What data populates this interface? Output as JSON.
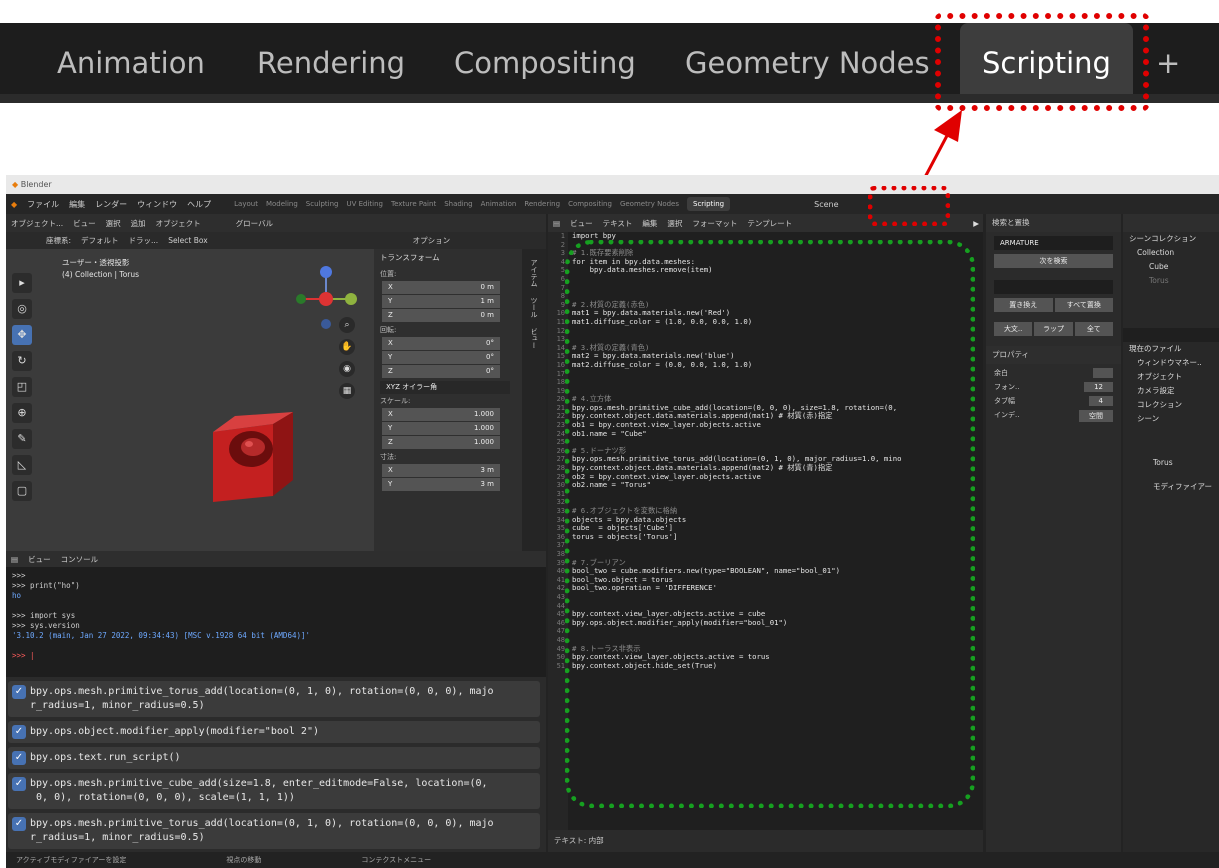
{
  "zoom_tabs": {
    "items": [
      "Animation",
      "Rendering",
      "Compositing",
      "Geometry Nodes"
    ],
    "active": "Scripting",
    "add": "+"
  },
  "window": {
    "title": "Blender"
  },
  "menu": {
    "items": [
      "ファイル",
      "編集",
      "レンダー",
      "ウィンドウ",
      "ヘルプ"
    ],
    "workspaces": [
      "Layout",
      "Modeling",
      "Sculpting",
      "UV Editing",
      "Texture Paint",
      "Shading",
      "Animation",
      "Rendering",
      "Compositing",
      "Geometry Nodes"
    ],
    "active_workspace": "Scripting",
    "scene": "Scene"
  },
  "viewport": {
    "header": [
      "オブジェクト...",
      "ビュー",
      "選択",
      "追加",
      "オブジェクト",
      "グローバル"
    ],
    "sub": [
      "座標系:",
      "デフォルト",
      "ドラッ...",
      "Select Box"
    ],
    "options": "オプション",
    "info_line1": "ユーザー・透視投影",
    "info_line2": "(4) Collection | Torus",
    "npanel": {
      "transform": "トランスフォーム",
      "location": "位置:",
      "loc": [
        [
          "X",
          "0 m"
        ],
        [
          "Y",
          "1 m"
        ],
        [
          "Z",
          "0 m"
        ]
      ],
      "rotation": "回転:",
      "rot": [
        [
          "X",
          "0°"
        ],
        [
          "Y",
          "0°"
        ],
        [
          "Z",
          "0°"
        ]
      ],
      "mode": "XYZ オイラー角",
      "scale": "スケール:",
      "scl": [
        [
          "X",
          "1.000"
        ],
        [
          "Y",
          "1.000"
        ],
        [
          "Z",
          "1.000"
        ]
      ],
      "dims": "寸法:",
      "dim": [
        [
          "X",
          "3 m"
        ],
        [
          "Y",
          "3 m"
        ]
      ]
    },
    "tabs": [
      "アイテム",
      "ツール",
      "ビュー"
    ]
  },
  "console": {
    "header": [
      "ビュー",
      "コンソール"
    ],
    "lines": [
      {
        "cls": "in",
        "t": ">>>"
      },
      {
        "cls": "in",
        "t": ">>> print(\"ho\")"
      },
      {
        "cls": "out",
        "t": "ho"
      },
      {
        "cls": "in",
        "t": ""
      },
      {
        "cls": "in",
        "t": ">>> import sys"
      },
      {
        "cls": "in",
        "t": ">>> sys.version"
      },
      {
        "cls": "out",
        "t": "'3.10.2 (main, Jan 27 2022, 09:34:43) [MSC v.1928 64 bit (AMD64)]'"
      },
      {
        "cls": "in",
        "t": ""
      },
      {
        "cls": "err",
        "t": ">>> |"
      }
    ]
  },
  "info": [
    "bpy.ops.mesh.primitive_torus_add(location=(0, 1, 0), rotation=(0, 0, 0), majo\nr_radius=1, minor_radius=0.5)",
    "bpy.ops.object.modifier_apply(modifier=\"bool 2\")",
    "bpy.ops.text.run_script()",
    "bpy.ops.mesh.primitive_cube_add(size=1.8, enter_editmode=False, location=(0,\n 0, 0), rotation=(0, 0, 0), scale=(1, 1, 1))",
    "bpy.ops.mesh.primitive_torus_add(location=(0, 1, 0), rotation=(0, 0, 0), majo\nr_radius=1, minor_radius=0.5)"
  ],
  "status": [
    "アクティブモディファイアーを設定",
    "視点の移動",
    "コンテクストメニュー"
  ],
  "text_editor": {
    "header": [
      "ビュー",
      "テキスト",
      "編集",
      "選択",
      "フォーマット",
      "テンプレート"
    ],
    "footer": "テキスト: 内部",
    "lines": [
      {
        "c": "",
        "t": "import bpy"
      },
      {
        "c": "",
        "t": ""
      },
      {
        "c": "cm",
        "t": "# 1.既存要素削除"
      },
      {
        "c": "",
        "t": "for item in bpy.data.meshes:"
      },
      {
        "c": "",
        "t": "    bpy.data.meshes.remove(item)"
      },
      {
        "c": "",
        "t": ""
      },
      {
        "c": "",
        "t": ""
      },
      {
        "c": "",
        "t": ""
      },
      {
        "c": "cm",
        "t": "# 2.材質の定義(赤色)"
      },
      {
        "c": "",
        "t": "mat1 = bpy.data.materials.new('Red')"
      },
      {
        "c": "",
        "t": "mat1.diffuse_color = (1.0, 0.0, 0.0, 1.0)"
      },
      {
        "c": "",
        "t": ""
      },
      {
        "c": "",
        "t": ""
      },
      {
        "c": "cm",
        "t": "# 3.材質の定義(青色)"
      },
      {
        "c": "",
        "t": "mat2 = bpy.data.materials.new('blue')"
      },
      {
        "c": "",
        "t": "mat2.diffuse_color = (0.0, 0.0, 1.0, 1.0)"
      },
      {
        "c": "",
        "t": ""
      },
      {
        "c": "",
        "t": ""
      },
      {
        "c": "",
        "t": ""
      },
      {
        "c": "cm",
        "t": "# 4.立方体"
      },
      {
        "c": "",
        "t": "bpy.ops.mesh.primitive_cube_add(location=(0, 0, 0), size=1.8, rotation=(0,"
      },
      {
        "c": "",
        "t": "bpy.context.object.data.materials.append(mat1) # 材質(赤)指定"
      },
      {
        "c": "",
        "t": "ob1 = bpy.context.view_layer.objects.active"
      },
      {
        "c": "",
        "t": "ob1.name = \"Cube\""
      },
      {
        "c": "",
        "t": ""
      },
      {
        "c": "cm",
        "t": "# 5.ドーナツ形"
      },
      {
        "c": "",
        "t": "bpy.ops.mesh.primitive_torus_add(location=(0, 1, 0), major_radius=1.0, mino"
      },
      {
        "c": "",
        "t": "bpy.context.object.data.materials.append(mat2) # 材質(青)指定"
      },
      {
        "c": "",
        "t": "ob2 = bpy.context.view_layer.objects.active"
      },
      {
        "c": "",
        "t": "ob2.name = \"Torus\""
      },
      {
        "c": "",
        "t": ""
      },
      {
        "c": "",
        "t": ""
      },
      {
        "c": "cm",
        "t": "# 6.オブジェクトを変数に格納"
      },
      {
        "c": "",
        "t": "objects = bpy.data.objects"
      },
      {
        "c": "",
        "t": "cube  = objects['Cube']"
      },
      {
        "c": "",
        "t": "torus = objects['Torus']"
      },
      {
        "c": "",
        "t": ""
      },
      {
        "c": "",
        "t": ""
      },
      {
        "c": "cm",
        "t": "# 7.ブーリアン"
      },
      {
        "c": "",
        "t": "bool_two = cube.modifiers.new(type=\"BOOLEAN\", name=\"bool_01\")"
      },
      {
        "c": "",
        "t": "bool_two.object = torus"
      },
      {
        "c": "",
        "t": "bool_two.operation = 'DIFFERENCE'"
      },
      {
        "c": "",
        "t": ""
      },
      {
        "c": "",
        "t": ""
      },
      {
        "c": "",
        "t": "bpy.context.view_layer.objects.active = cube"
      },
      {
        "c": "",
        "t": "bpy.ops.object.modifier_apply(modifier=\"bool_01\")"
      },
      {
        "c": "",
        "t": ""
      },
      {
        "c": "",
        "t": ""
      },
      {
        "c": "cm",
        "t": "# 8.トーラス非表示"
      },
      {
        "c": "",
        "t": "bpy.context.view_layer.objects.active = torus"
      },
      {
        "c": "",
        "t": "bpy.context.object.hide_set(True)"
      }
    ]
  },
  "search_panel": {
    "header": "検索と置換",
    "find": "ARMATURE",
    "find_next": "次を検索",
    "replace_all": "すべて置換",
    "replace": "置き換え",
    "opts": [
      "大文..",
      "ラップ",
      "全て"
    ],
    "props": "プロパティ",
    "margin": "余白",
    "font_label": "フォン..",
    "font_val": "12",
    "tab_label": "タブ幅",
    "tab_val": "4",
    "indent_label": "インデ..",
    "indent_val": "空間"
  },
  "outliner": {
    "scene_collection": "シーンコレクション",
    "collection": "Collection",
    "cube": "Cube",
    "torus": "Torus",
    "file_items": [
      "現在のファイル",
      "ウィンドウマネー..",
      "オブジェクト",
      "カメラ設定",
      "コレクション",
      "シーン"
    ],
    "torus_props": "Torus",
    "modifier": "モディファイアー"
  }
}
